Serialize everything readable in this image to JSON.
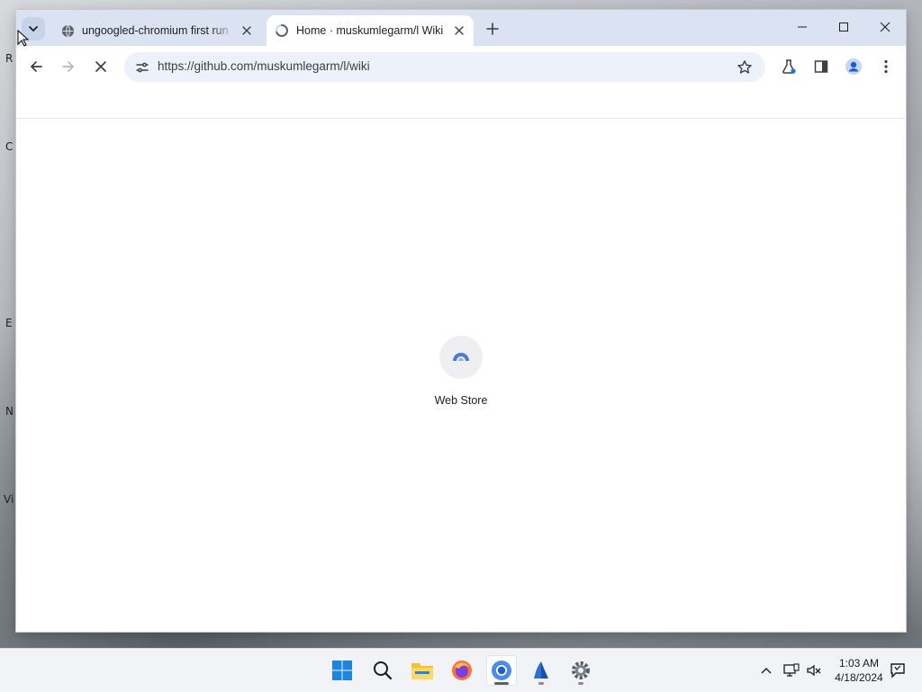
{
  "desktop": {
    "icon_labels": [
      "R",
      "C",
      "E",
      "N",
      "Vi"
    ]
  },
  "browser": {
    "tabs": [
      {
        "title": "ungoogled-chromium first run",
        "favicon": "globe-icon",
        "active": false
      },
      {
        "title": "Home · muskumlegarm/l Wiki",
        "favicon": "loading-spinner-icon",
        "active": true
      }
    ],
    "address_bar": {
      "url": "https://github.com/muskumlegarm/l/wiki"
    },
    "toolbar_icons": [
      "back-icon",
      "forward-icon",
      "stop-loading-icon",
      "site-info-icon",
      "bookmark-star-icon",
      "labs-flask-icon",
      "side-panel-icon",
      "profile-icon",
      "menu-icon"
    ]
  },
  "page": {
    "shortcut_label": "Web Store"
  },
  "taskbar": {
    "apps": [
      "start-icon",
      "search-icon",
      "file-explorer-icon",
      "firefox-icon",
      "chromium-icon",
      "app-icon",
      "settings-icon"
    ],
    "clock": {
      "time": "1:03 AM",
      "date": "4/18/2024"
    }
  },
  "colors": {
    "tabstrip": "#dbe3f3",
    "omnibox": "#edf1f9",
    "accent": "#1a73e8",
    "taskbar": "#f1f3f6"
  }
}
